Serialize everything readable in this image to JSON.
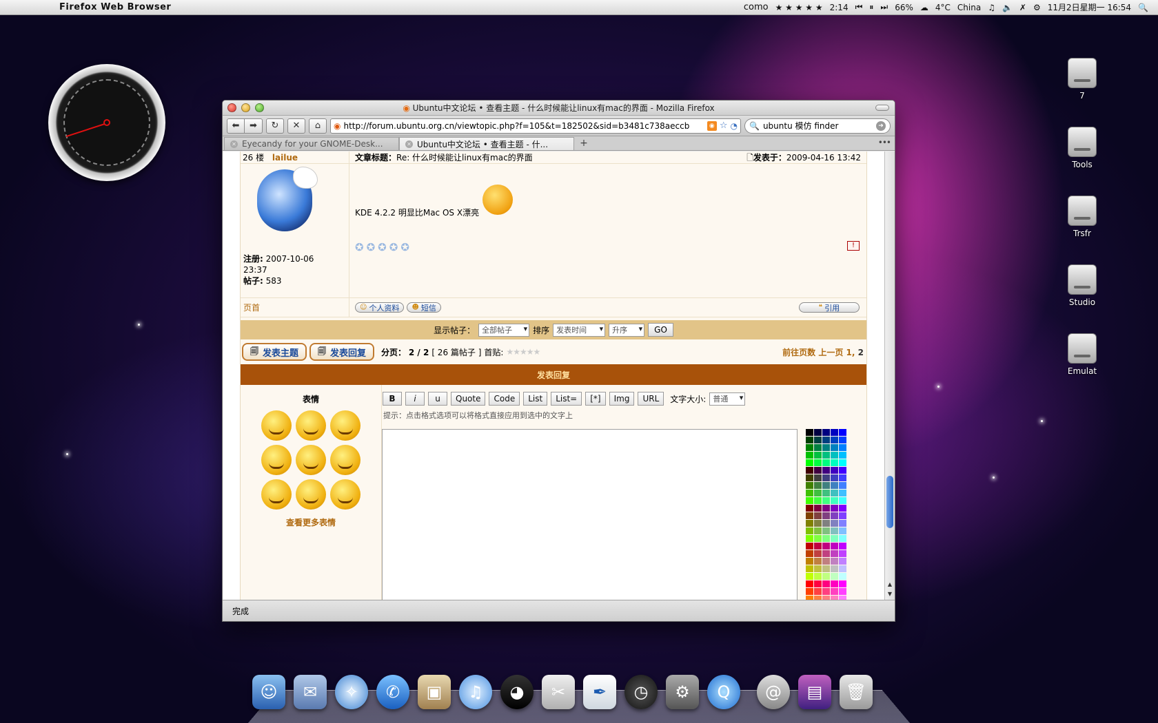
{
  "menubar": {
    "app_name": "Firefox Web Browser",
    "user": "como",
    "rating": "★ ★ ★ ★ ★",
    "track_time": "2:14",
    "battery": "66%",
    "weather_temp": "4°C",
    "weather_loc": "China",
    "datetime": "11月2日星期一 16:54"
  },
  "desktop_icons": [
    {
      "label": "7"
    },
    {
      "label": "Tools"
    },
    {
      "label": "Trsfr"
    },
    {
      "label": "Studio"
    },
    {
      "label": "Emulat"
    }
  ],
  "window": {
    "title": "Ubuntu中文论坛 • 查看主题 - 什么时候能让linux有mac的界面 - Mozilla Firefox",
    "url": "http://forum.ubuntu.org.cn/viewtopic.php?f=105&t=182502&sid=b3481c738aeccb",
    "search_value": "ubuntu 模仿 finder",
    "tabs": [
      {
        "label": "Eyecandy for your GNOME-Desk...",
        "active": false
      },
      {
        "label": "Ubuntu中文论坛 • 查看主题 - 什...",
        "active": true
      }
    ],
    "status": "完成"
  },
  "post": {
    "floor": "26 楼",
    "author": "lailue",
    "subject_label": "文章标题：",
    "subject": "Re: 什么时候能让linux有mac的界面",
    "posted_label": "发表于：",
    "posted": "2009-04-16 13:42",
    "text": "KDE 4.2.2 明显比Mac OS X漂亮",
    "reg_label": "注册:",
    "reg_date": "2007-10-06",
    "reg_time": "23:37",
    "posts_label": "帖子:",
    "posts": "583",
    "report": "!",
    "top_link": "页首",
    "profile_btn": "个人资料",
    "pm_btn": "短信",
    "quote_btn": "引用"
  },
  "sortbar": {
    "display_label": "显示帖子：",
    "display_value": "全部帖子",
    "sort_label": "排序",
    "sort_value": "发表时间",
    "order_value": "升序",
    "go": "GO"
  },
  "pagebar": {
    "new_topic": "发表主题",
    "reply": "发表回复",
    "pages_label": "分页：",
    "pages": "2 / 2",
    "posts_count": "[ 26 篇帖子 ]",
    "first_post": "首贴:",
    "goto_label": "前往页数",
    "prev": "上一页",
    "page_1": "1",
    "page_2": "2"
  },
  "reply": {
    "header": "发表回复",
    "smilies_title": "表情",
    "more_smilies": "查看更多表情",
    "buttons": [
      "B",
      "i",
      "u",
      "Quote",
      "Code",
      "List",
      "List=",
      "[*]",
      "Img",
      "URL"
    ],
    "size_label": "文字大小:",
    "size_value": "普通",
    "hint": "提示：点击格式选项可以将格式直接应用到选中的文字上"
  },
  "colors": {
    "accent": "#a8520a",
    "sortbar": "#e2c488",
    "link": "#b06a10"
  }
}
